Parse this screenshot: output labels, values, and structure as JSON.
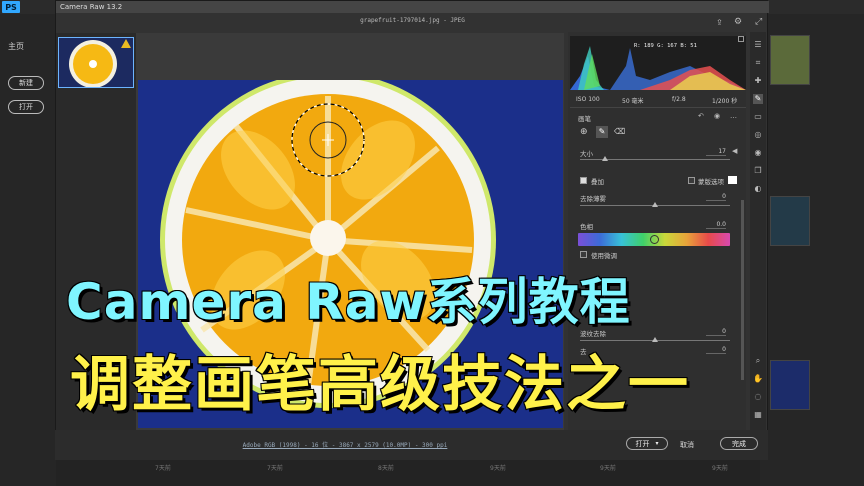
{
  "photoshop": {
    "logo": "PS",
    "home_label": "主页",
    "new_button": "新建",
    "open_button": "打开",
    "time_labels": [
      "7天前",
      "7天前",
      "8天前",
      "9天前",
      "9天前",
      "9天前"
    ]
  },
  "camera_raw": {
    "window_title": "Camera Raw 13.2",
    "file_name": "grapefruit-1797014.jpg  -  JPEG",
    "histogram_readout": "R: 189   G: 167   B: 51",
    "camera_info": {
      "iso": "ISO 100",
      "focal": "50 毫米",
      "aperture": "f/2.8",
      "shutter": "1/200 秒"
    },
    "brush_panel": {
      "title": "画笔",
      "size_label": "大小",
      "size_value": "17",
      "overlay_label": "叠加",
      "overlay_checked": true,
      "mask_label": "蒙版选项",
      "defringe_label": "去除薄雾",
      "defringe_value": "0",
      "color_label": "色相",
      "color_value": "0.0",
      "use_fine_label": "使用微调",
      "moire_label": "波纹去除",
      "moire_value": "0",
      "fringe_label": "去",
      "fringe_value": "0",
      "hue_position": 0.5
    },
    "footer": {
      "workflow_link": "Adobe RGB (1998) - 16 位 - 3867 x 2579 (10.0MP) - 300 ppi",
      "open_button": "打开",
      "cancel_button": "取消",
      "done_button": "完成"
    }
  },
  "overlay": {
    "title_line1": "Camera Raw系列教程",
    "title_line2": "调整画笔高级技法之一"
  },
  "colors": {
    "title_line1": "#7ff5ff",
    "title_line2": "#fff14a",
    "photo_background": "#1b2f8a",
    "accent": "#31a8ff"
  }
}
